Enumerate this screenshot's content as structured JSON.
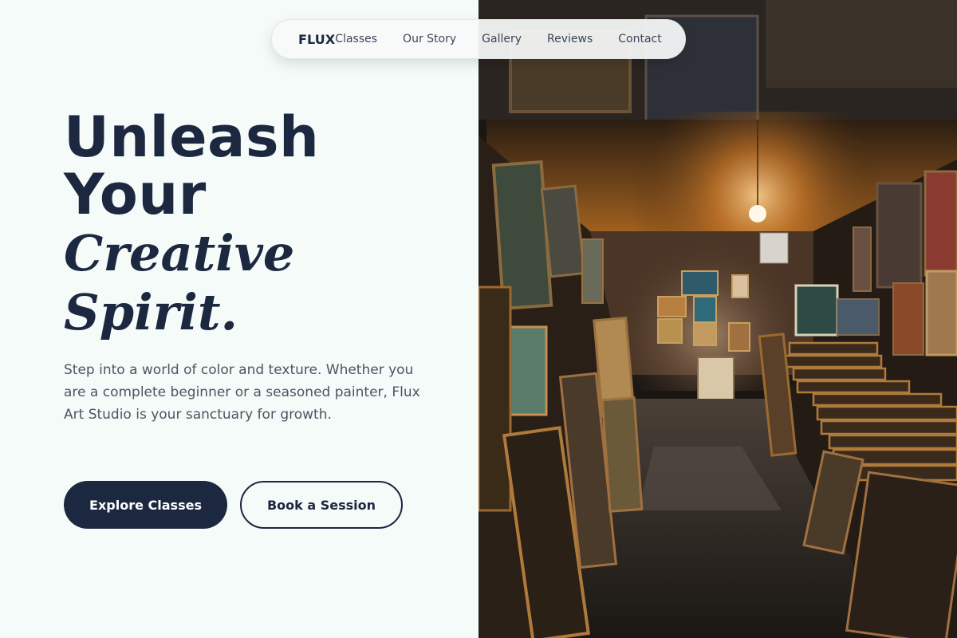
{
  "nav": {
    "brand": "FLUX",
    "links": [
      "Classes",
      "Our Story",
      "Gallery",
      "Reviews",
      "Contact"
    ]
  },
  "hero": {
    "headline": [
      "Unleash",
      "Your",
      "Creative",
      "Spirit."
    ],
    "description": "Step into a world of color and texture. Whether you are a complete beginner or a seasoned painter, Flux Art Studio is your sanctuary for growth.",
    "primary_cta": "Explore Classes",
    "secondary_cta": "Book a Session"
  },
  "colors": {
    "navy": "#1c2740",
    "background": "#f4fbf8",
    "text_muted": "#4b5563"
  },
  "image": {
    "semantic": "art-gallery-corridor-photo"
  }
}
